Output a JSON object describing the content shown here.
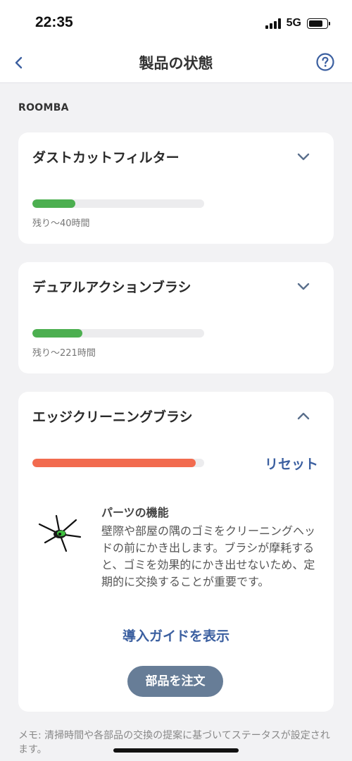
{
  "status_bar": {
    "time": "22:35",
    "network": "5G"
  },
  "nav": {
    "title": "製品の状態",
    "back_icon": "chevron-left-icon",
    "help_icon": "question-circle-icon"
  },
  "section": {
    "label": "ROOMBA"
  },
  "parts": [
    {
      "name": "ダストカットフィルター",
      "remaining": "残り～40時間",
      "progress": 0.25,
      "color": "#4caf50",
      "expanded": false
    },
    {
      "name": "デュアルアクションブラシ",
      "remaining": "残り～221時間",
      "progress": 0.29,
      "color": "#4caf50",
      "expanded": false
    },
    {
      "name": "エッジクリーニングブラシ",
      "progress": 0.95,
      "color": "#f26b4f",
      "expanded": true,
      "reset_label": "リセット",
      "function_title": "パーツの機能",
      "function_desc": "壁際や部屋の隅のゴミをクリーニングヘッドの前にかき出します。ブラシが摩耗すると、ゴミを効果的にかき出せないため、定期的に交換することが重要です。",
      "guide_label": "導入ガイドを表示",
      "order_label": "部品を注文"
    }
  ],
  "memo": "メモ: 清掃時間や各部品の交換の提案に基づいてステータスが設定されます。",
  "colors": {
    "accent": "#3b5fa0",
    "green": "#4caf50",
    "warning": "#f26b4f",
    "button": "#677d97"
  }
}
